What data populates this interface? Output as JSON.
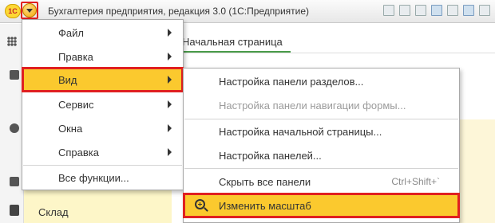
{
  "window": {
    "logo_text": "1С",
    "title": "Бухгалтерия предприятия, редакция 3.0  (1С:Предприятие)"
  },
  "tab": {
    "label": "Начальная страница"
  },
  "sidebar": {
    "section_label": "Склад"
  },
  "main_menu": {
    "items": [
      {
        "label": "Файл",
        "has_submenu": true
      },
      {
        "label": "Правка",
        "has_submenu": true
      },
      {
        "label": "Вид",
        "has_submenu": true,
        "active": true
      },
      {
        "label": "Сервис",
        "has_submenu": true
      },
      {
        "label": "Окна",
        "has_submenu": true
      },
      {
        "label": "Справка",
        "has_submenu": true
      }
    ],
    "all_functions": "Все функции..."
  },
  "submenu_vid": {
    "items": [
      {
        "label": "Настройка панели разделов...",
        "disabled": false
      },
      {
        "label": "Настройка панели навигации формы...",
        "disabled": true
      },
      {
        "label": "Настройка начальной страницы...",
        "disabled": false
      },
      {
        "label": "Настройка панелей...",
        "disabled": false
      },
      {
        "label": "Скрыть все панели",
        "shortcut": "Ctrl+Shift+`",
        "disabled": false
      },
      {
        "label": "Изменить масштаб",
        "icon": "zoom-in-icon",
        "active": true
      }
    ]
  },
  "colors": {
    "highlight": "#fbc92e",
    "callout_border": "#e02020",
    "sections_panel": "#fdf6c8",
    "tab_underline": "#4a9b4a"
  }
}
